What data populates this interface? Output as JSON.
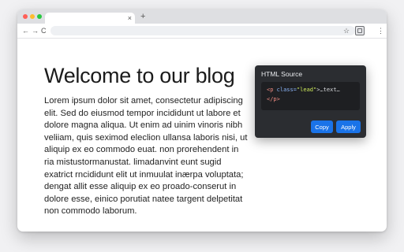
{
  "browser": {
    "tab_close": "×",
    "new_tab": "+",
    "back": "←",
    "forward": "→",
    "reload": "C",
    "star": "☆",
    "menu": "⋮"
  },
  "page": {
    "heading": "Welcome to our blog",
    "body": "Lorem ipsum dolor sit amet, consectetur adipiscing elit. Sed do eiusmod tempor incididunt ut labore et dolore magna aliqua. Ut enim ad uinim vinoris nibh veliiam, quis seximod eleclion ullansa laboris nisi, ut aliquip ex eo commodo euat. non prorehendent in ria mistustormanustat. limadanvint eunt sugid exatrict rncididunt elit ut inmuulat inærpa voluptata; dengat allit esse aliquip ex eo proado-conserut in dolore esse, einico porutiat natee targent delpetitat non commodo laborum."
  },
  "popup": {
    "title": "HTML Source",
    "code": {
      "open_tag": "<p",
      "attr": "class=",
      "value": "\"lead\"",
      "rest": ">…text…",
      "close_tag": "</p>"
    },
    "copy_label": "Copy",
    "apply_label": "Apply"
  },
  "icons": [
    "close-icon",
    "plus-icon",
    "back-arrow-icon",
    "forward-arrow-icon",
    "reload-icon",
    "star-icon",
    "extension-icon",
    "menu-icon"
  ],
  "colors": {
    "accent": "#1a73e8",
    "popup_bg": "#2b2d31",
    "code_bg": "#1e1f22"
  }
}
